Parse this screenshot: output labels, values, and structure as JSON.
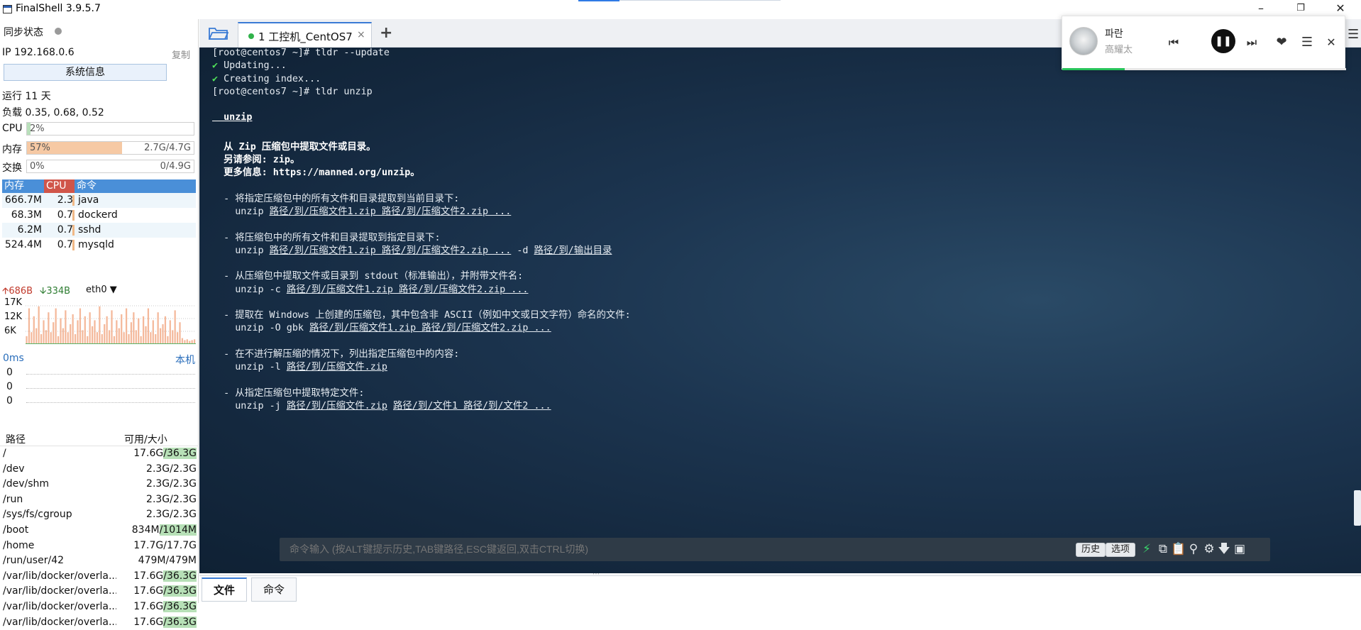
{
  "window": {
    "title": "FinalShell 3.9.5.7",
    "minimize_icon": "minimize-icon",
    "restore_icon": "restore-icon",
    "close_icon": "close-icon"
  },
  "left_panel": {
    "sync_status": "同步状态",
    "ip": "IP 192.168.0.6",
    "copy": "复制",
    "sysinfo_button": "系统信息",
    "uptime": "运行 11 天",
    "load": "负载 0.35, 0.68, 0.52",
    "cpu": {
      "label": "CPU",
      "pct": "2%",
      "fraction": 0.02,
      "value": ""
    },
    "mem": {
      "label": "内存",
      "pct": "57%",
      "fraction": 0.57,
      "value": "2.7G/4.7G"
    },
    "swap": {
      "label": "交换",
      "pct": "0%",
      "fraction": 0.0,
      "value": "0/4.9G"
    },
    "proc_headers": {
      "mem": "内存",
      "cpu": "CPU",
      "cmd": "命令"
    },
    "processes": [
      {
        "mem": "666.7M",
        "cpu": "2.3",
        "cmd": "java"
      },
      {
        "mem": "68.3M",
        "cpu": "0.7",
        "cmd": "dockerd"
      },
      {
        "mem": "6.2M",
        "cpu": "0.7",
        "cmd": "sshd"
      },
      {
        "mem": "524.4M",
        "cpu": "0.7",
        "cmd": "mysqld"
      }
    ],
    "net": {
      "up": "686B",
      "down": "334B",
      "interface": "eth0",
      "y_labels": [
        "17K",
        "12K",
        "6K"
      ],
      "bars": [
        0.2,
        0.9,
        0.3,
        0.7,
        0.4,
        0.95,
        0.25,
        0.6,
        0.35,
        0.8,
        0.3,
        0.55,
        0.9,
        0.2,
        0.65,
        0.4,
        0.85,
        0.3,
        0.5,
        0.75,
        0.25,
        0.6,
        0.9,
        0.35,
        0.7,
        0.2,
        0.8,
        0.45,
        0.6,
        0.3,
        0.95,
        0.25,
        0.5,
        0.7,
        0.35,
        0.85,
        0.2,
        0.6,
        0.4,
        0.75,
        0.3,
        0.9,
        0.25,
        0.55,
        0.8,
        0.35,
        0.65,
        0.2,
        0.7,
        0.45,
        0.9,
        0.3,
        0.6,
        0.25,
        0.8,
        0.4,
        0.5,
        0.7,
        0.2,
        0.6,
        0.35,
        0.85,
        0.3,
        0.55,
        0.15,
        0.1,
        0.12,
        0.08,
        0.1,
        0.12
      ]
    },
    "ping": {
      "ms": "0ms",
      "local": "本机",
      "values": [
        "0",
        "0",
        "0"
      ]
    },
    "disk_headers": {
      "path": "路径",
      "size": "可用/大小"
    },
    "disks": [
      {
        "path": "/",
        "used": "17.6G",
        "total": "36.3G",
        "hl": true
      },
      {
        "path": "/dev",
        "used": "2.3G",
        "total": "2.3G",
        "hl": false
      },
      {
        "path": "/dev/shm",
        "used": "2.3G",
        "total": "2.3G",
        "hl": false
      },
      {
        "path": "/run",
        "used": "2.3G",
        "total": "2.3G",
        "hl": false
      },
      {
        "path": "/sys/fs/cgroup",
        "used": "2.3G",
        "total": "2.3G",
        "hl": false
      },
      {
        "path": "/boot",
        "used": "834M",
        "total": "1014M",
        "hl": true
      },
      {
        "path": "/home",
        "used": "17.7G",
        "total": "17.7G",
        "hl": false
      },
      {
        "path": "/run/user/42",
        "used": "479M",
        "total": "479M",
        "hl": false
      },
      {
        "path": "/var/lib/docker/overla...",
        "used": "17.6G",
        "total": "36.3G",
        "hl": true
      },
      {
        "path": "/var/lib/docker/overla...",
        "used": "17.6G",
        "total": "36.3G",
        "hl": true
      },
      {
        "path": "/var/lib/docker/overla...",
        "used": "17.6G",
        "total": "36.3G",
        "hl": true
      },
      {
        "path": "/var/lib/docker/overla...",
        "used": "17.6G",
        "total": "36.3G",
        "hl": true
      }
    ]
  },
  "tabs": {
    "active_label": "1 工控机_CentOS7",
    "close": "×",
    "add": "+"
  },
  "terminal": {
    "lines": [
      {
        "t": "[root@centos7 ~]# tldr --update"
      },
      {
        "t": "✔ Updating...",
        "check": true
      },
      {
        "t": "✔ Creating index...",
        "check": true
      },
      {
        "t": "[root@centos7 ~]# tldr unzip"
      },
      {
        "t": ""
      },
      {
        "t": "  unzip",
        "bold": true,
        "underline_all": true
      },
      {
        "t": ""
      },
      {
        "t": "  从 Zip 压缩包中提取文件或目录。",
        "bold": true
      },
      {
        "t": "  另请参阅: zip。",
        "bold": true
      },
      {
        "t": "  更多信息: https://manned.org/unzip。",
        "bold": true
      },
      {
        "t": ""
      },
      {
        "t": "  - 将指定压缩包中的所有文件和目录提取到当前目录下:"
      },
      {
        "t": "    unzip ",
        "u": "路径/到/压缩文件1.zip 路径/到/压缩文件2.zip ..."
      },
      {
        "t": ""
      },
      {
        "t": "  - 将压缩包中的所有文件和目录提取到指定目录下:"
      },
      {
        "t": "    unzip ",
        "u": "路径/到/压缩文件1.zip 路径/到/压缩文件2.zip ...",
        "t2": " -d ",
        "u2": "路径/到/输出目录"
      },
      {
        "t": ""
      },
      {
        "t": "  - 从压缩包中提取文件或目录到 stdout（标准输出），并附带文件名:"
      },
      {
        "t": "    unzip -c ",
        "u": "路径/到/压缩文件1.zip 路径/到/压缩文件2.zip ..."
      },
      {
        "t": ""
      },
      {
        "t": "  - 提取在 Windows 上创建的压缩包，其中包含非 ASCII（例如中文或日文字符）命名的文件:"
      },
      {
        "t": "    unzip -O gbk ",
        "u": "路径/到/压缩文件1.zip 路径/到/压缩文件2.zip ..."
      },
      {
        "t": ""
      },
      {
        "t": "  - 在不进行解压缩的情况下，列出指定压缩包中的内容:"
      },
      {
        "t": "    unzip -l ",
        "u": "路径/到/压缩文件.zip"
      },
      {
        "t": ""
      },
      {
        "t": "  - 从指定压缩包中提取特定文件:"
      },
      {
        "t": "    unzip -j ",
        "u": "路径/到/压缩文件.zip",
        "t2": " ",
        "u2": "路径/到/文件1 路径/到/文件2 ..."
      }
    ]
  },
  "cmdbar": {
    "placeholder": "命令输入 (按ALT键提示历史,TAB键路径,ESC键返回,双击CTRL切换)",
    "history": "历史",
    "options": "选项"
  },
  "bottom_tabs": {
    "file": "文件",
    "command": "命令"
  },
  "player": {
    "title": "파란",
    "artist": "高耀太",
    "progress": 0.22,
    "accent": "#28c35a"
  }
}
